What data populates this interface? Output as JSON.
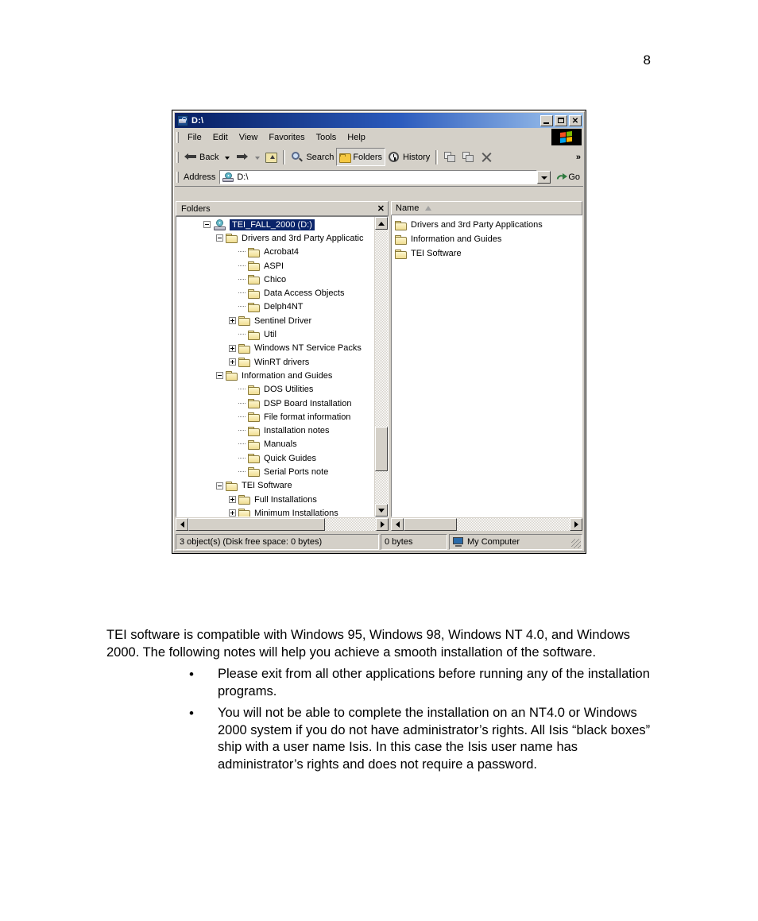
{
  "page": {
    "number": "8",
    "paragraph": "TEI software is compatible with Windows 95, Windows 98, Windows NT 4.0, and Windows 2000. The following notes will help you achieve a smooth installation of the software.",
    "bullets": [
      "Please exit from all other applications before running any of the installation programs.",
      "You will not be able to complete the installation on an NT4.0 or Windows 2000 system if you do not have administrator’s rights. All Isis “black boxes” ship with a user name Isis. In this case the Isis user name has administrator’s rights and does not require a password.",
      "•"
    ],
    "bullet_glyph": "•"
  },
  "window": {
    "title": "D:\\",
    "title_icon": "drive-search-icon",
    "controls": {
      "minimize": "minimize-button",
      "maximize": "maximize-button",
      "close_glyph": "✕"
    },
    "menu": [
      "File",
      "Edit",
      "View",
      "Favorites",
      "Tools",
      "Help"
    ],
    "toolbar": {
      "back": "Back",
      "forward": "",
      "up": "",
      "search": "Search",
      "folders": "Folders",
      "history": "History",
      "move_to": "",
      "copy_to": "",
      "delete": "",
      "overflow": "»"
    },
    "address": {
      "label": "Address",
      "value": "D:\\",
      "go": "Go"
    },
    "folders_pane": {
      "title": "Folders",
      "close_glyph": "✕",
      "tree": [
        {
          "label": "TEI_FALL_2000 (D:)",
          "indent": 0,
          "expander": "minus",
          "icon": "drive",
          "selected": true
        },
        {
          "label": "Drivers and 3rd Party Applicatic",
          "indent": 1,
          "expander": "minus",
          "icon": "folder",
          "selected": false
        },
        {
          "label": "Acrobat4",
          "indent": 2,
          "expander": "none",
          "icon": "folder",
          "selected": false
        },
        {
          "label": "ASPI",
          "indent": 2,
          "expander": "none",
          "icon": "folder",
          "selected": false
        },
        {
          "label": "Chico",
          "indent": 2,
          "expander": "none",
          "icon": "folder",
          "selected": false
        },
        {
          "label": "Data Access Objects",
          "indent": 2,
          "expander": "none",
          "icon": "folder",
          "selected": false
        },
        {
          "label": "Delph4NT",
          "indent": 2,
          "expander": "none",
          "icon": "folder",
          "selected": false
        },
        {
          "label": "Sentinel Driver",
          "indent": 2,
          "expander": "plus",
          "icon": "folder",
          "selected": false
        },
        {
          "label": "Util",
          "indent": 2,
          "expander": "none",
          "icon": "folder",
          "selected": false
        },
        {
          "label": "Windows NT Service Packs",
          "indent": 2,
          "expander": "plus",
          "icon": "folder",
          "selected": false
        },
        {
          "label": "WinRT drivers",
          "indent": 2,
          "expander": "plus",
          "icon": "folder",
          "selected": false
        },
        {
          "label": "Information and Guides",
          "indent": 1,
          "expander": "minus",
          "icon": "folder",
          "selected": false
        },
        {
          "label": "DOS Utilities",
          "indent": 2,
          "expander": "none",
          "icon": "folder",
          "selected": false
        },
        {
          "label": "DSP Board Installation",
          "indent": 2,
          "expander": "none",
          "icon": "folder",
          "selected": false
        },
        {
          "label": "File format information",
          "indent": 2,
          "expander": "none",
          "icon": "folder",
          "selected": false
        },
        {
          "label": "Installation notes",
          "indent": 2,
          "expander": "none",
          "icon": "folder",
          "selected": false
        },
        {
          "label": "Manuals",
          "indent": 2,
          "expander": "none",
          "icon": "folder",
          "selected": false
        },
        {
          "label": "Quick Guides",
          "indent": 2,
          "expander": "none",
          "icon": "folder",
          "selected": false
        },
        {
          "label": "Serial Ports note",
          "indent": 2,
          "expander": "none",
          "icon": "folder",
          "selected": false
        },
        {
          "label": "TEI Software",
          "indent": 1,
          "expander": "minus",
          "icon": "folder",
          "selected": false
        },
        {
          "label": "Full Installations",
          "indent": 2,
          "expander": "plus",
          "icon": "folder",
          "selected": false
        },
        {
          "label": "Minimum Installations",
          "indent": 2,
          "expander": "plus",
          "icon": "folder",
          "selected": false
        }
      ]
    },
    "list_pane": {
      "column": "Name",
      "sort": "ascending",
      "items": [
        "Drivers and 3rd Party Applications",
        "Information and Guides",
        "TEI Software"
      ]
    },
    "statusbar": {
      "objects": "3 object(s) (Disk free space: 0 bytes)",
      "size": "0 bytes",
      "zone": "My Computer"
    }
  },
  "colors": {
    "titlebar_start": "#0a246a",
    "titlebar_end": "#a6caf0",
    "face": "#d4d0c8",
    "selection": "#0a246a",
    "folder_yellow": "#f0dd92"
  }
}
